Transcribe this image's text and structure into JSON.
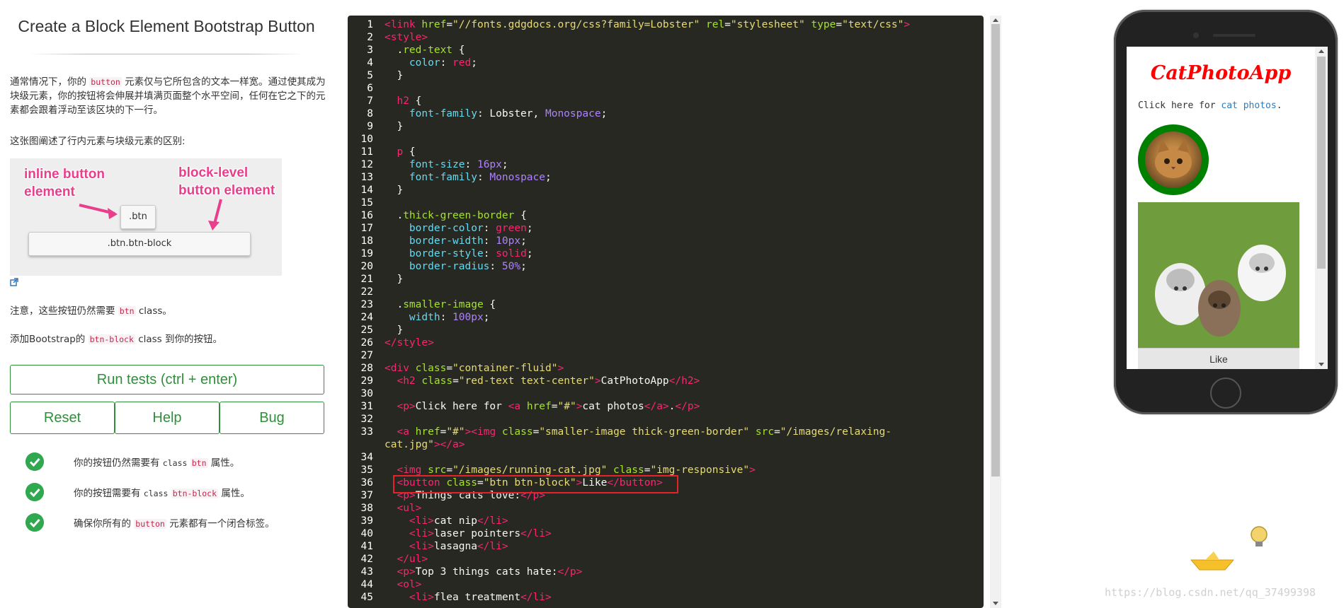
{
  "left": {
    "title": "Create a Block Element Bootstrap Button",
    "p1": {
      "a": "通常情况下，你的 ",
      "code": "button",
      "b": " 元素仅与它所包含的文本一样宽。通过使其成为块级元素，你的按钮将会伸展并填满页面整个水平空间，任何在它之下的元素都会跟着浮动至该区块的下一行。"
    },
    "p2": "这张图阐述了行内元素与块级元素的区别:",
    "diagram": {
      "inline_label_1": "inline button",
      "inline_label_2": "element",
      "block_label_1": "block-level",
      "block_label_2": "button element",
      "btn_label": ".btn",
      "btn_block_label": ".btn.btn-block"
    },
    "p3": {
      "a": "注意，这些按钮仍然需要 ",
      "code": "btn",
      "b": " class。"
    },
    "p4": {
      "a": "添加Bootstrap的 ",
      "code": "btn-block",
      "b": " class 到你的按钮。"
    },
    "buttons": {
      "run": "Run tests (ctrl + enter)",
      "reset": "Reset",
      "help": "Help",
      "bug": "Bug"
    },
    "tests": [
      {
        "a": "你的按钮仍然需要有 ",
        "class_word": "class",
        "code": "btn",
        "b": " 属性。"
      },
      {
        "a": "你的按钮需要有 ",
        "class_word": "class",
        "code": "btn-block",
        "b": " 属性。"
      },
      {
        "a": "确保你所有的 ",
        "code": "button",
        "b": " 元素都有一个闭合标签。"
      }
    ]
  },
  "editor": {
    "line_numbers": [
      "1",
      "2",
      "3",
      "4",
      "5",
      "6",
      "7",
      "8",
      "9",
      "10",
      "11",
      "12",
      "13",
      "14",
      "15",
      "16",
      "17",
      "18",
      "19",
      "20",
      "21",
      "22",
      "23",
      "24",
      "25",
      "26",
      "27",
      "28",
      "29",
      "30",
      "31",
      "32",
      "33",
      "",
      "34",
      "35",
      "36",
      "37",
      "38",
      "39",
      "40",
      "41",
      "42",
      "43",
      "44",
      "45"
    ]
  },
  "preview": {
    "app_title": "CatPhotoApp",
    "para_a": "Click here for ",
    "para_link": "cat photos",
    "para_b": ".",
    "like_label": "Like"
  },
  "watermark": "https://blog.csdn.net/qq_37499398",
  "colors": {
    "success_green": "#2fa84f",
    "button_green": "#2f8f3a",
    "editor_bg": "#272822",
    "highlight_red": "#e8222a",
    "app_title_red": "#ff0000",
    "diagram_pink": "#e83e8c"
  }
}
